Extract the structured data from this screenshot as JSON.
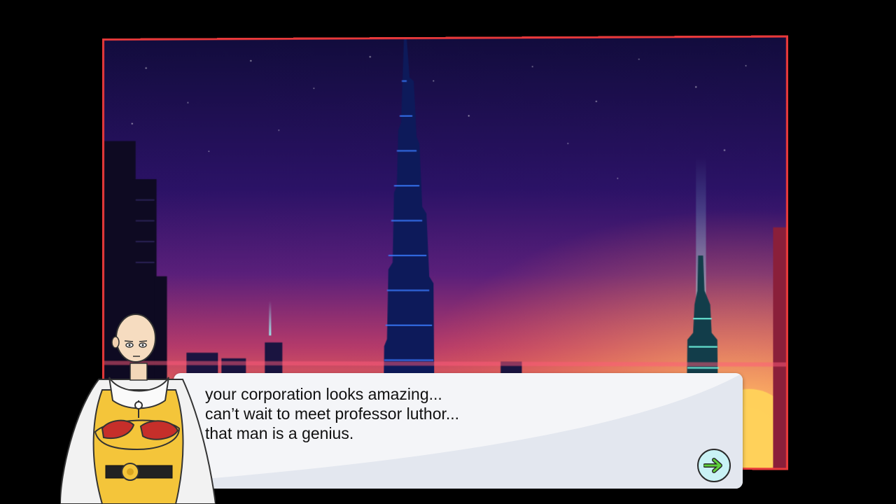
{
  "scene": {
    "background": "night-city-skyline",
    "frame_color": "#e8393a"
  },
  "character": {
    "name_icon": "bald-hero-portrait"
  },
  "dialog": {
    "lines": [
      "your corporation looks amazing...",
      "can’t wait to meet professor luthor...",
      "that man is a genius."
    ]
  },
  "controls": {
    "next_icon": "arrow-right-icon",
    "next_color": "#c9f2f5",
    "arrow_color": "#5fd13a"
  }
}
